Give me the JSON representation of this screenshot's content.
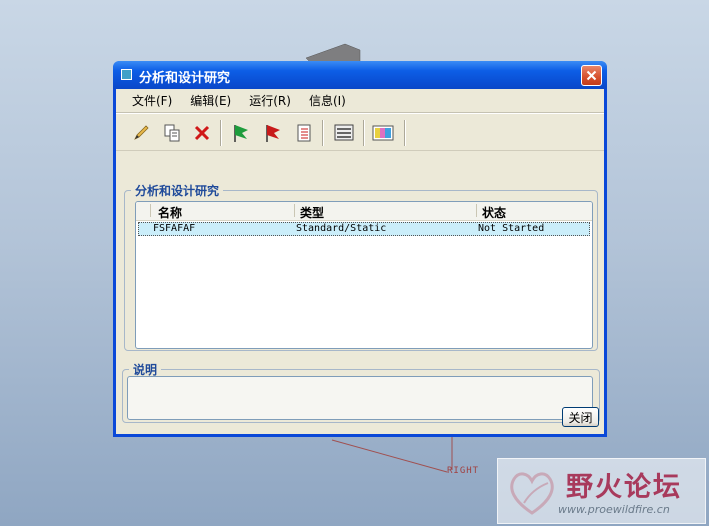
{
  "dialog": {
    "title": "分析和设计研究",
    "menu": [
      "文件(F)",
      "编辑(E)",
      "运行(R)",
      "信息(I)"
    ],
    "toolbar_icons": [
      "pencil-icon",
      "copy-icon",
      "delete-icon",
      "green-flag-icon",
      "red-flag-icon",
      "list-icon",
      "display-icon",
      "color-icon"
    ],
    "studies_group_label": "分析和设计研究",
    "columns": [
      "名称",
      "类型",
      "状态"
    ],
    "rows": [
      {
        "name": "FSFAFAF",
        "type": "Standard/Static",
        "status": "Not Started"
      }
    ],
    "description_label": "说明",
    "description": "",
    "close_label": "关闭"
  },
  "background": {
    "model_label": "RIGHT"
  },
  "watermark": {
    "title": "野火论坛",
    "url": "www.proewildfire.cn"
  }
}
